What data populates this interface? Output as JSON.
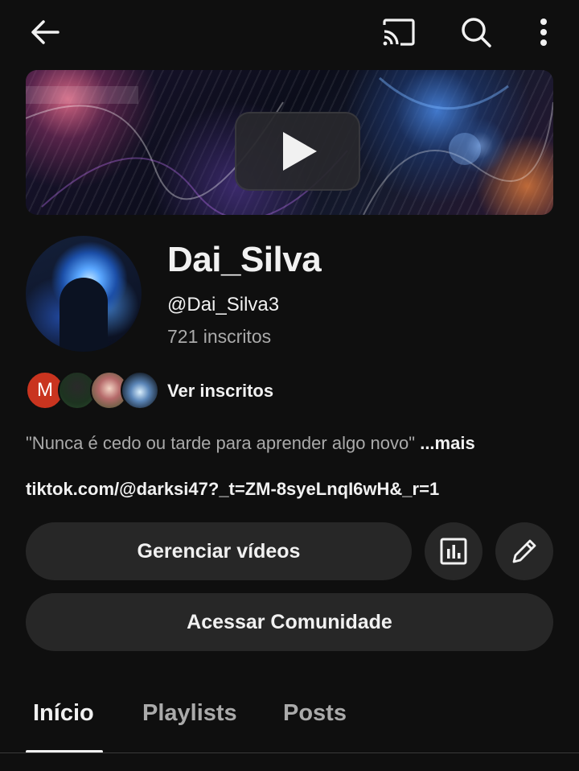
{
  "toolbar": {
    "back_icon": "arrow-left-icon",
    "cast_icon": "cast-icon",
    "search_icon": "search-icon",
    "more_icon": "more-vertical-icon"
  },
  "banner": {
    "play_icon": "youtube-play-icon"
  },
  "channel": {
    "name": "Dai_Silva",
    "handle": "@Dai_Silva3",
    "subscribers": "721 inscritos"
  },
  "subscribers_preview": {
    "first_initial": "M",
    "label": "Ver inscritos",
    "initial_color": "#c9341f"
  },
  "about": {
    "description": "\"Nunca é cedo ou tarde para aprender algo novo\"",
    "more_label": "...mais",
    "link": "tiktok.com/@darksi47?_t=ZM-8syeLnqI6wH&_r=1"
  },
  "actions": {
    "manage_videos": "Gerenciar vídeos",
    "stats_icon": "analytics-icon",
    "edit_icon": "pencil-icon",
    "community": "Acessar Comunidade"
  },
  "tabs": [
    {
      "label": "Início",
      "active": true
    },
    {
      "label": "Playlists",
      "active": false
    },
    {
      "label": "Posts",
      "active": false
    }
  ],
  "colors": {
    "background": "#0f0f0f",
    "button_bg": "#272727",
    "text_primary": "#f1f1f1",
    "text_secondary": "#aaaaaa"
  }
}
